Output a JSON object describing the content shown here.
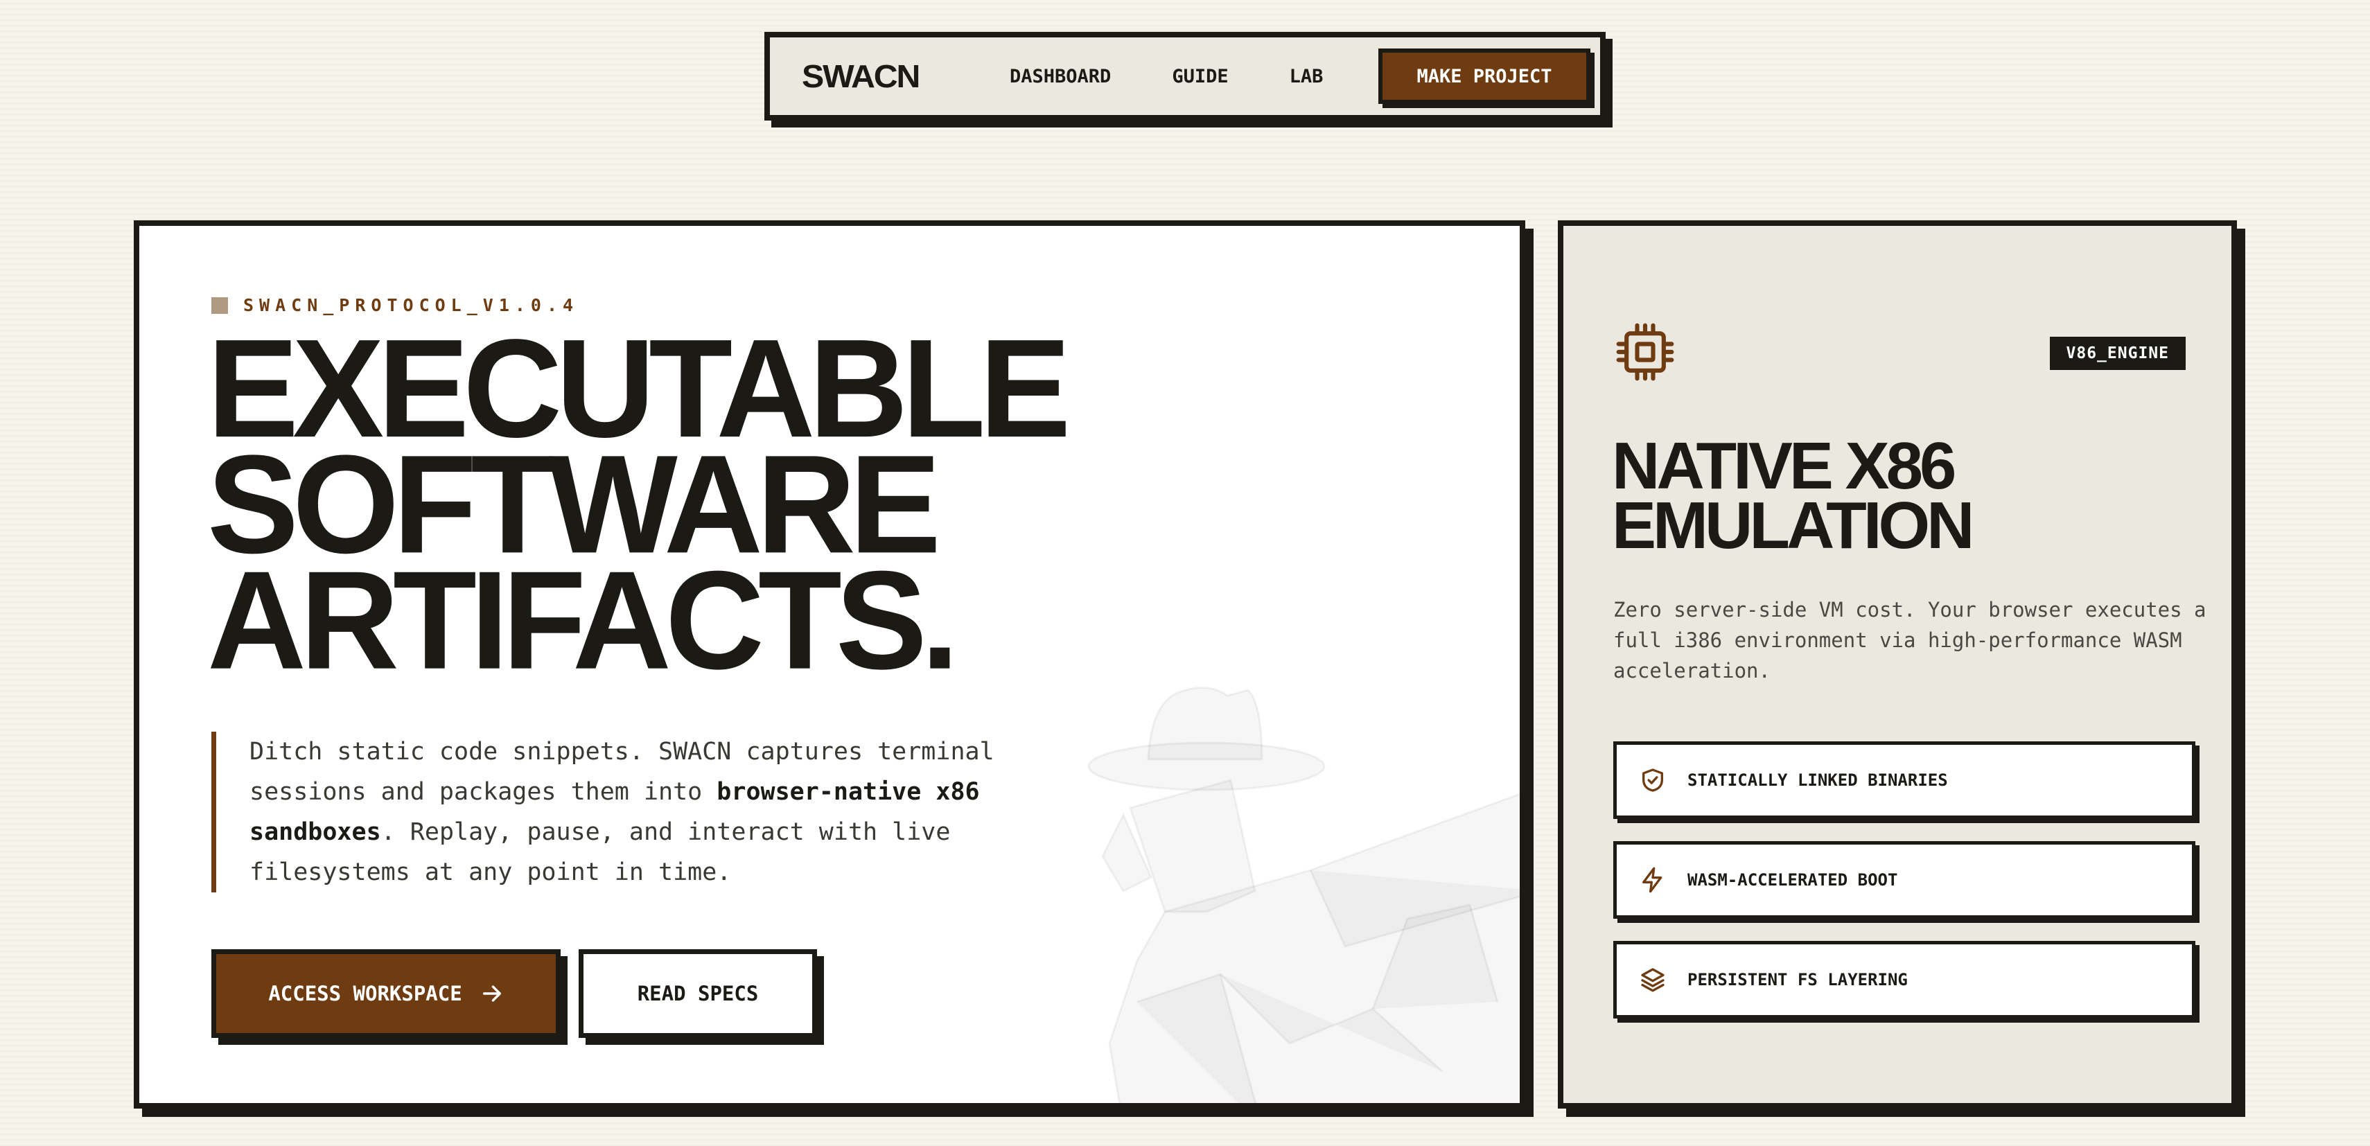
{
  "nav": {
    "brand": "SWACN",
    "links": [
      "DASHBOARD",
      "GUIDE",
      "LAB"
    ],
    "cta": "MAKE PROJECT"
  },
  "hero": {
    "protocol": "SWACN_PROTOCOL_V1.0.4",
    "headline": [
      "EXECUTABLE",
      "SOFTWARE",
      "ARTIFACTS."
    ],
    "desc_before": "Ditch static code snippets. SWACN captures terminal sessions and packages them into ",
    "desc_bold": "browser-native x86 sandboxes",
    "desc_after": ". Replay, pause, and interact with live filesystems at any point in time.",
    "primary_button": "ACCESS WORKSPACE",
    "secondary_button": "READ SPECS",
    "watermark_icon": "duck-icon"
  },
  "side": {
    "icon": "cpu-chip-icon",
    "badge": "V86_ENGINE",
    "title": [
      "NATIVE X86",
      "EMULATION"
    ],
    "desc": "Zero server-side VM cost. Your browser executes a full i386 environment via high-performance WASM acceleration.",
    "features": [
      {
        "icon": "shield-check-icon",
        "label": "STATICALLY LINKED BINARIES"
      },
      {
        "icon": "lightning-icon",
        "label": "WASM-ACCELERATED BOOT"
      },
      {
        "icon": "layers-icon",
        "label": "PERSISTENT FS LAYERING"
      }
    ]
  },
  "colors": {
    "accent": "#6f3c12",
    "ink": "#1b1a15",
    "paper": "#f6f3ea",
    "panel": "#ebe8e0"
  }
}
